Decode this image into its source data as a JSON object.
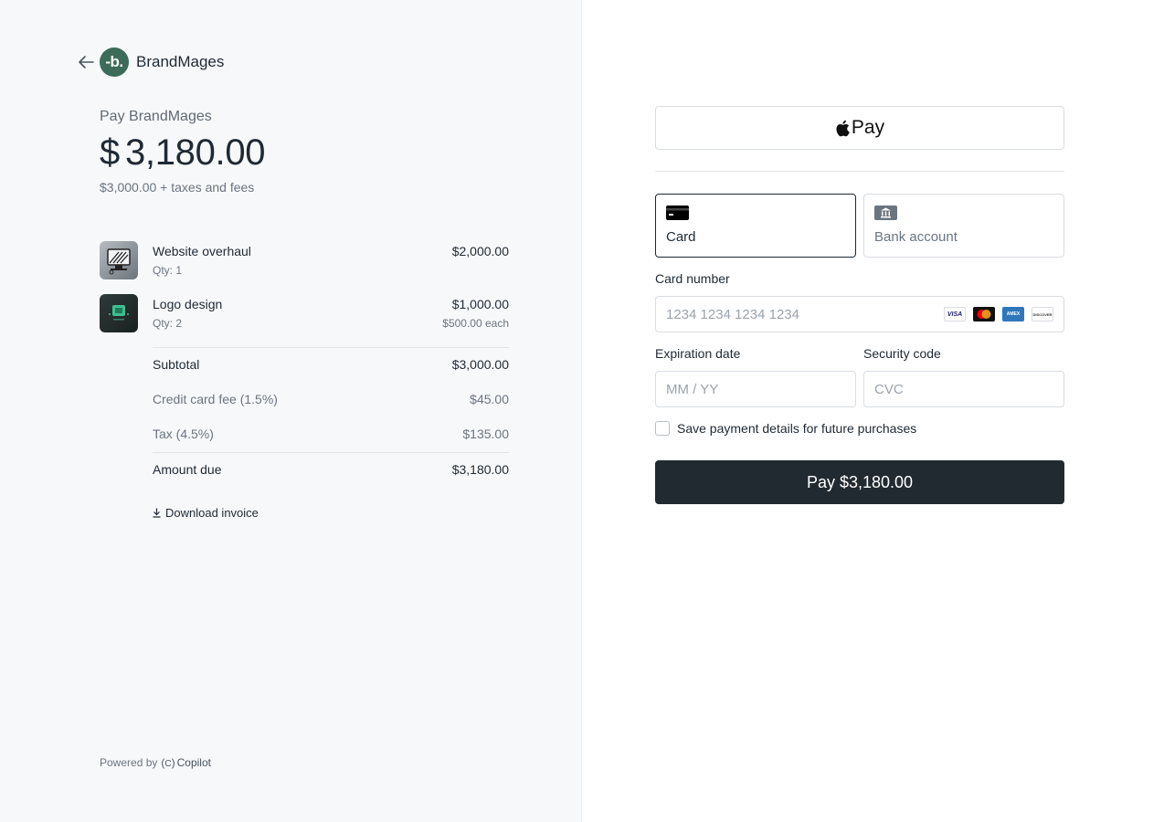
{
  "merchant": {
    "name": "BrandMages",
    "logo_text": "-b.",
    "logo_color": "#3d6b5a"
  },
  "summary": {
    "pay_label": "Pay BrandMages",
    "currency_symbol": "$",
    "amount": "3,180.00",
    "amount_sub": "$3,000.00 + taxes and fees"
  },
  "items": [
    {
      "name": "Website overhaul",
      "qty": "Qty: 1",
      "price": "$2,000.00",
      "each": ""
    },
    {
      "name": "Logo design",
      "qty": "Qty: 2",
      "price": "$1,000.00",
      "each": "$500.00 each"
    }
  ],
  "totals": {
    "subtotal_label": "Subtotal",
    "subtotal_value": "$3,000.00",
    "fee_label": "Credit card fee (1.5%)",
    "fee_value": "$45.00",
    "tax_label": "Tax (4.5%)",
    "tax_value": "$135.00",
    "due_label": "Amount due",
    "due_value": "$3,180.00"
  },
  "download_label": "Download invoice",
  "powered": {
    "prefix": "Powered by",
    "brand": "Copilot"
  },
  "payment": {
    "applepay_label": "Pay",
    "tabs": [
      {
        "label": "Card",
        "selected": true
      },
      {
        "label": "Bank account",
        "selected": false
      }
    ],
    "card_number_label": "Card number",
    "card_number_placeholder": "1234 1234 1234 1234",
    "card_brands": [
      "VISA",
      "mastercard",
      "AMEX",
      "DISCOVER"
    ],
    "expiry_label": "Expiration date",
    "expiry_placeholder": "MM / YY",
    "cvc_label": "Security code",
    "cvc_placeholder": "CVC",
    "save_label": "Save payment details for future purchases",
    "save_checked": false,
    "pay_button": "Pay $3,180.00",
    "pay_button_color": "#222a31"
  }
}
